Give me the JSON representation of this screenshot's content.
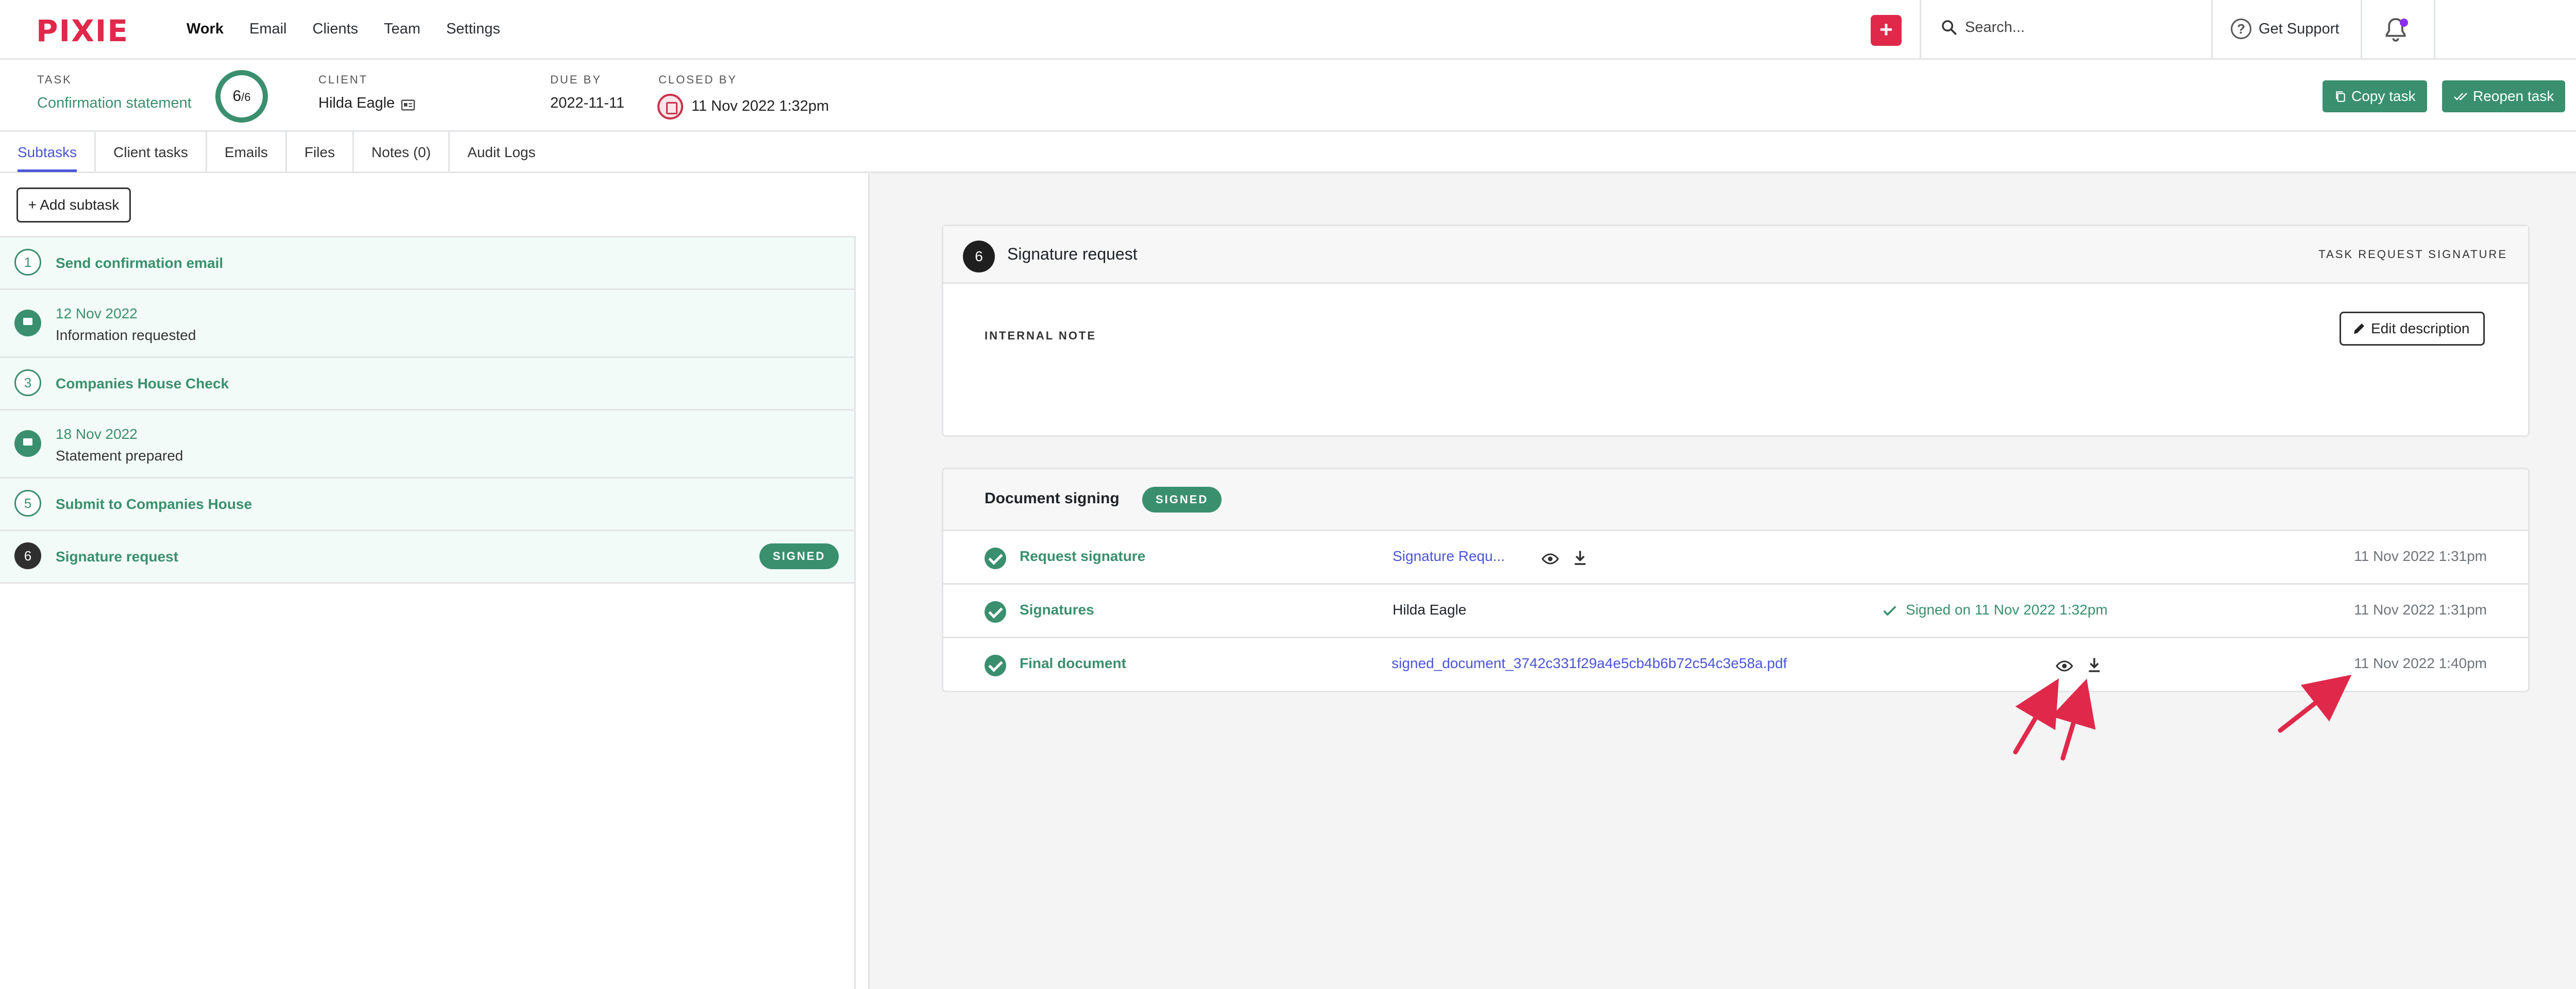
{
  "nav": {
    "logo": "PIXIE",
    "links": [
      "Work",
      "Email",
      "Clients",
      "Team",
      "Settings"
    ],
    "active": "Work",
    "plus_label": "+",
    "search_placeholder": "Search...",
    "support_label": "Get Support"
  },
  "task_header": {
    "task_label": "TASK",
    "task_value": "Confirmation statement",
    "progress_main": "6",
    "progress_total": "/6",
    "client_label": "CLIENT",
    "client_value": "Hilda Eagle",
    "due_label": "DUE BY",
    "due_value": "2022-11-11",
    "closed_label": "CLOSED BY",
    "closed_value": "11 Nov 2022 1:32pm",
    "copy_label": "Copy task",
    "reopen_label": "Reopen task"
  },
  "tabs": [
    {
      "label": "Subtasks",
      "active": true
    },
    {
      "label": "Client tasks"
    },
    {
      "label": "Emails"
    },
    {
      "label": "Files"
    },
    {
      "label": "Notes (0)"
    },
    {
      "label": "Audit Logs"
    }
  ],
  "subtasks": {
    "add_label": "+ Add subtask",
    "items": [
      {
        "num": "1",
        "title": "Send confirmation email"
      },
      {
        "title": "12 Nov 2022",
        "subtitle": "Information requested",
        "icon": "flag-icon"
      },
      {
        "num": "3",
        "title": "Companies House Check"
      },
      {
        "title": "18 Nov 2022",
        "subtitle": "Statement prepared",
        "icon": "flag-icon"
      },
      {
        "num": "5",
        "title": "Submit to Companies House"
      },
      {
        "num": "6",
        "title": "Signature request",
        "badge": "SIGNED"
      }
    ]
  },
  "detail": {
    "step_num": "6",
    "title": "Signature request",
    "tag": "TASK REQUEST SIGNATURE",
    "internal_note_label": "INTERNAL NOTE",
    "edit_label": "Edit description"
  },
  "signing": {
    "title": "Document signing",
    "badge": "SIGNED",
    "rows": [
      {
        "label": "Request signature",
        "mid": "Signature Requ...",
        "time": "11 Nov 2022 1:31pm"
      },
      {
        "label": "Signatures",
        "mid": "Hilda Eagle",
        "signed": "Signed on 11 Nov 2022 1:32pm",
        "time": "11 Nov 2022 1:31pm"
      },
      {
        "label": "Final document",
        "mid": "signed_document_3742c331f29a4e5cb4b6b72c54c3e58a.pdf",
        "time": "11 Nov 2022 1:40pm"
      }
    ]
  },
  "colors": {
    "accent": "#3a8f6e",
    "brand_red": "#e0294a",
    "link": "#4a56d6",
    "annotation_arrow": "#e0294a"
  }
}
